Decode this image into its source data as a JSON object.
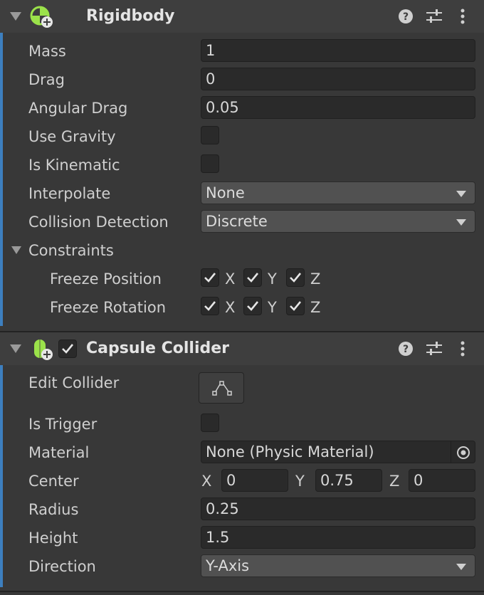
{
  "rigidbody": {
    "title": "Rigidbody",
    "icons": {
      "component": "rigidbody-icon",
      "help": "help-icon",
      "presets": "presets-icon",
      "menu": "kebab-menu-icon"
    },
    "mass_label": "Mass",
    "mass_value": "1",
    "drag_label": "Drag",
    "drag_value": "0",
    "angular_drag_label": "Angular Drag",
    "angular_drag_value": "0.05",
    "use_gravity_label": "Use Gravity",
    "use_gravity_checked": false,
    "is_kinematic_label": "Is Kinematic",
    "is_kinematic_checked": false,
    "interpolate_label": "Interpolate",
    "interpolate_value": "None",
    "collision_detection_label": "Collision Detection",
    "collision_detection_value": "Discrete",
    "constraints_label": "Constraints",
    "freeze_position_label": "Freeze Position",
    "freeze_rotation_label": "Freeze Rotation",
    "axis_x": "X",
    "axis_y": "Y",
    "axis_z": "Z"
  },
  "capsule_collider": {
    "title": "Capsule Collider",
    "enabled": true,
    "icons": {
      "component": "capsule-collider-icon",
      "help": "help-icon",
      "presets": "presets-icon",
      "menu": "kebab-menu-icon",
      "edit": "edit-collider-icon",
      "picker": "object-picker-icon"
    },
    "edit_collider_label": "Edit Collider",
    "is_trigger_label": "Is Trigger",
    "is_trigger_checked": false,
    "material_label": "Material",
    "material_value": "None (Physic Material)",
    "center_label": "Center",
    "center_x_label": "X",
    "center_x": "0",
    "center_y_label": "Y",
    "center_y": "0.75",
    "center_z_label": "Z",
    "center_z": "0",
    "radius_label": "Radius",
    "radius_value": "0.25",
    "height_label": "Height",
    "height_value": "1.5",
    "direction_label": "Direction",
    "direction_value": "Y-Axis"
  },
  "colors": {
    "accent": "#3d7fbf",
    "background": "#383838",
    "header": "#3e3e3e",
    "rigidbody_icon": "#9be24a"
  }
}
